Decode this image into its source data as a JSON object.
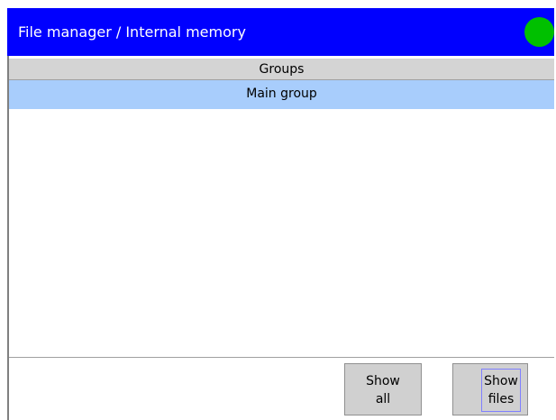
{
  "window": {
    "title": "File manager / Internal memory",
    "status_color": "#00c000",
    "titlebar_color": "#0000ff"
  },
  "groups": {
    "header": "Groups",
    "items": [
      {
        "label": "Main group",
        "selected": true
      }
    ]
  },
  "buttons": {
    "show_all": {
      "line1": "Show",
      "line2": "all"
    },
    "show_files": {
      "line1": "Show",
      "line2": "files"
    }
  }
}
